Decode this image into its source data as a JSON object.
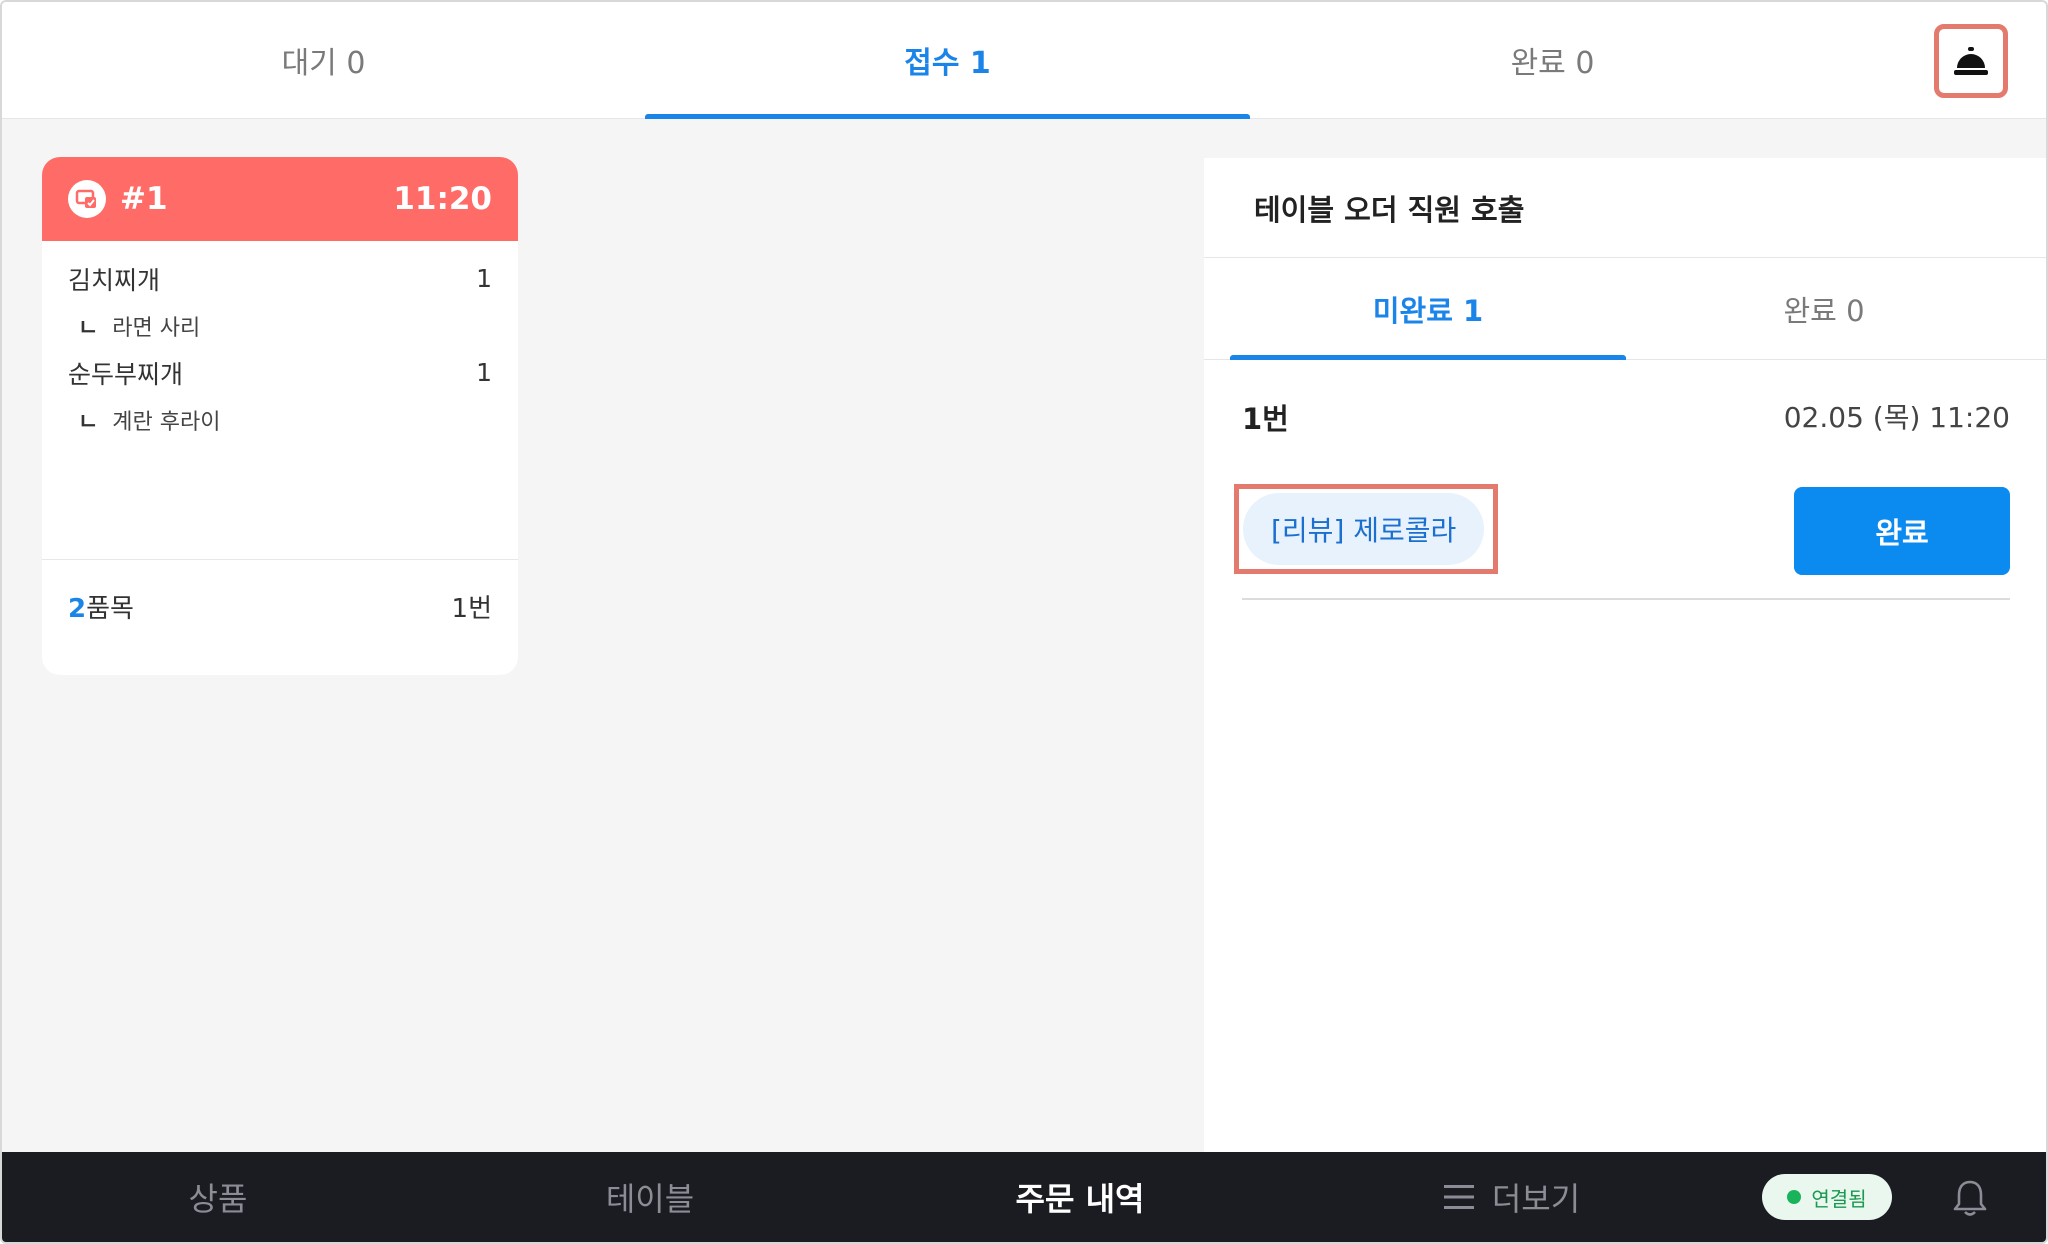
{
  "top_tabs": [
    {
      "label": "대기 0"
    },
    {
      "label": "접수 1"
    },
    {
      "label": "완료 0"
    }
  ],
  "order_card": {
    "number": "#1",
    "time": "11:20",
    "items": [
      {
        "name": "김치찌개",
        "qty": "1",
        "option": "라면 사리"
      },
      {
        "name": "순두부찌개",
        "qty": "1",
        "option": "계란 후라이"
      }
    ],
    "option_mark": "ㄴ",
    "footer_count": "2",
    "footer_count_unit": "품목",
    "footer_table": "1번"
  },
  "staff_call_panel": {
    "title": "테이블 오더 직원 호출",
    "tabs": [
      {
        "label": "미완료 1"
      },
      {
        "label": "완료 0"
      }
    ],
    "call": {
      "table": "1번",
      "datetime": "02.05 (목) 11:20",
      "request": "[리뷰] 제로콜라",
      "done_label": "완료"
    }
  },
  "bottom_nav": {
    "items": [
      {
        "label": "상품"
      },
      {
        "label": "테이블"
      },
      {
        "label": "주문 내역"
      },
      {
        "label": "더보기"
      }
    ],
    "status": "연결됨"
  },
  "colors": {
    "accent": "#1a84e8",
    "card_header": "#ff6b67",
    "highlight_border": "#e37a6d",
    "nav_bg": "#1b1c22",
    "connected": "#19b45a"
  },
  "icons": {
    "staff_call": "service-bell-icon",
    "order_source": "tablet-order-icon",
    "more": "hamburger-icon",
    "notifications": "bell-outline-icon"
  }
}
